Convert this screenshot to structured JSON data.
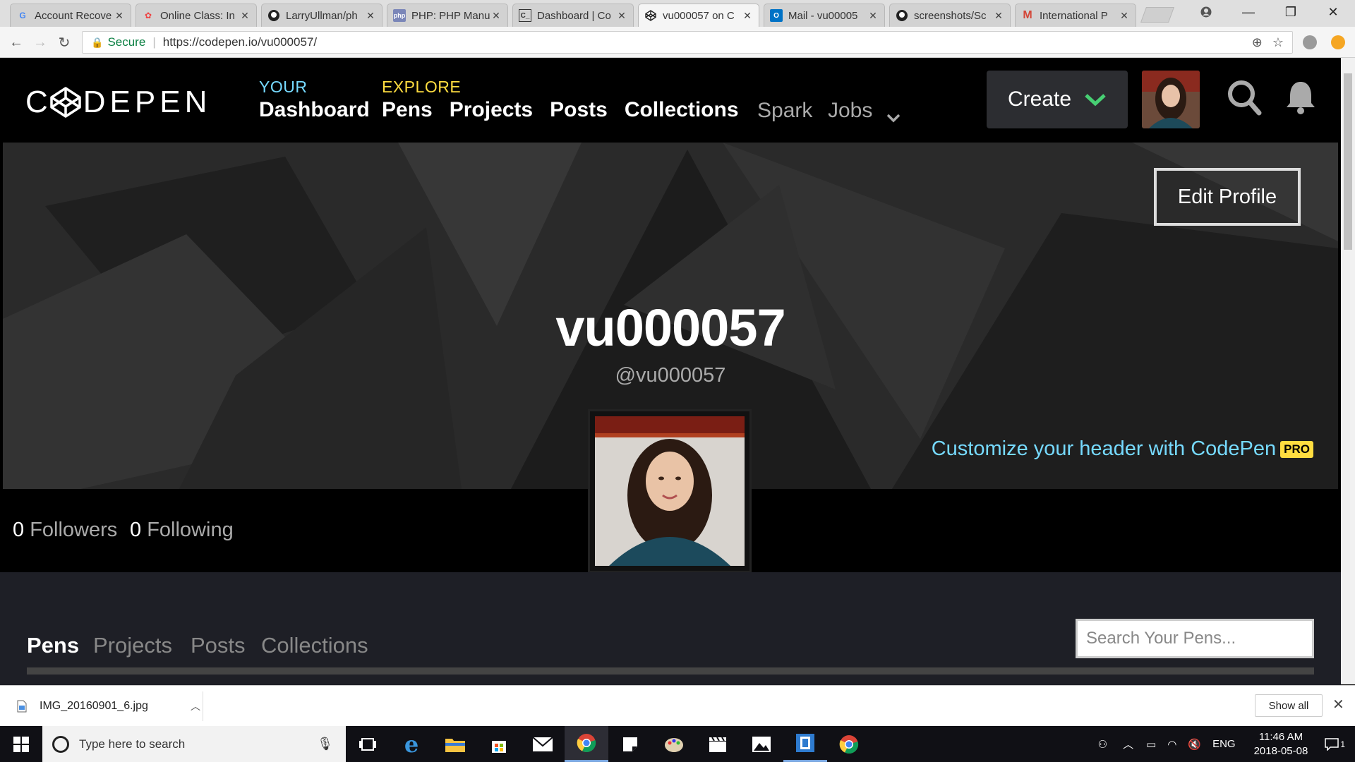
{
  "browser": {
    "tabs": [
      {
        "title": "Account Recove",
        "favicon": "google-icon",
        "active": false
      },
      {
        "title": "Online Class: In",
        "favicon": "class-icon",
        "active": false
      },
      {
        "title": "LarryUllman/ph",
        "favicon": "github-icon",
        "active": false
      },
      {
        "title": "PHP: PHP Manu",
        "favicon": "php-icon",
        "active": false
      },
      {
        "title": "Dashboard | Co",
        "favicon": "dashboard-icon",
        "active": false
      },
      {
        "title": "vu000057 on C",
        "favicon": "codepen-icon",
        "active": true
      },
      {
        "title": "Mail - vu00005",
        "favicon": "outlook-icon",
        "active": false
      },
      {
        "title": "screenshots/Sc",
        "favicon": "github-icon",
        "active": false
      },
      {
        "title": "International P",
        "favicon": "gmail-icon",
        "active": false
      }
    ],
    "security_label": "Secure",
    "url": "https://codepen.io/vu000057/"
  },
  "codepen": {
    "logo": "CODEPEN",
    "nav": {
      "your_caption": "YOUR",
      "your_links": [
        "Dashboard"
      ],
      "explore_caption": "EXPLORE",
      "explore_links": [
        "Pens",
        "Projects",
        "Posts",
        "Collections"
      ],
      "extra_links": [
        "Spark",
        "Jobs"
      ]
    },
    "create_label": "Create",
    "colors": {
      "your": "#76daff",
      "explore": "#ffdd40",
      "accent_green": "#47cf73",
      "link_blue": "#76daff"
    }
  },
  "profile": {
    "edit_label": "Edit Profile",
    "display_name": "vu000057",
    "handle": "@vu000057",
    "customize_text": "Customize your header with CodePen",
    "pro_badge": "PRO",
    "followers_count": "0",
    "followers_label": "Followers",
    "following_count": "0",
    "following_label": "Following"
  },
  "content_tabs": [
    "Pens",
    "Projects",
    "Posts",
    "Collections"
  ],
  "search_placeholder": "Search Your Pens...",
  "downloads": {
    "filename": "IMG_20160901_6.jpg",
    "show_all": "Show all"
  },
  "taskbar": {
    "search_placeholder": "Type here to search",
    "language": "ENG",
    "time": "11:46 AM",
    "date": "2018-05-08",
    "notifications": "1"
  }
}
